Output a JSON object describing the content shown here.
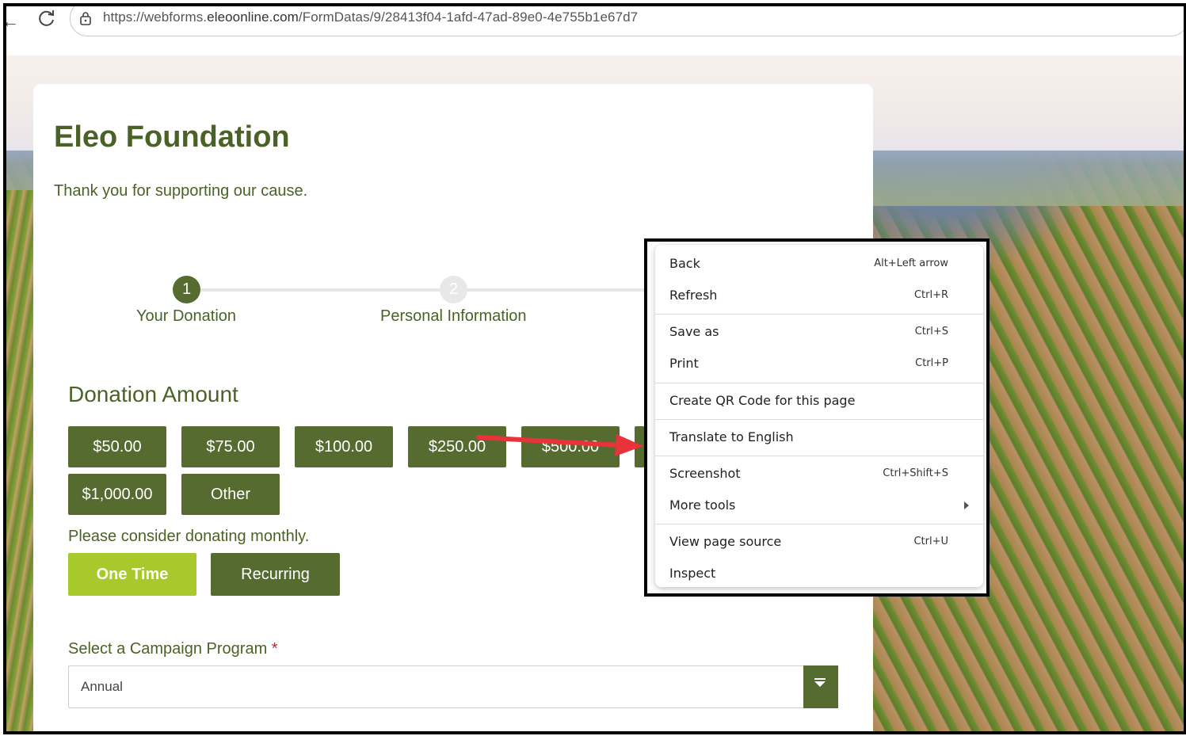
{
  "browser": {
    "url_prefix": "https://webforms.",
    "url_host": "eleoonline.com",
    "url_path": "/FormDatas/9/28413f04-1afd-47ad-89e0-4e755b1e67d7"
  },
  "form": {
    "title": "Eleo Foundation",
    "subtitle": "Thank you for supporting our cause.",
    "steps": [
      {
        "number": "1",
        "label": "Your Donation"
      },
      {
        "number": "2",
        "label": "Personal Information"
      }
    ],
    "donation_heading": "Donation Amount",
    "amounts": [
      "$50.00",
      "$75.00",
      "$100.00",
      "$250.00",
      "$500.00",
      "$1,000.00",
      "Other"
    ],
    "monthly_prompt": "Please consider donating monthly.",
    "frequency": {
      "one_time": "One Time",
      "recurring": "Recurring"
    },
    "campaign_label": "Select a Campaign Program",
    "required_mark": "*",
    "campaign_value": "Annual"
  },
  "context_menu": {
    "items": [
      {
        "label": "Back",
        "shortcut": "Alt+Left arrow"
      },
      {
        "label": "Refresh",
        "shortcut": "Ctrl+R"
      },
      {
        "label": "Save as",
        "shortcut": "Ctrl+S"
      },
      {
        "label": "Print",
        "shortcut": "Ctrl+P"
      },
      {
        "label": "Create QR Code for this page",
        "shortcut": ""
      },
      {
        "label": "Translate to English",
        "shortcut": ""
      },
      {
        "label": "Screenshot",
        "shortcut": "Ctrl+Shift+S"
      },
      {
        "label": "More tools",
        "shortcut": ""
      },
      {
        "label": "View page source",
        "shortcut": "Ctrl+U"
      },
      {
        "label": "Inspect",
        "shortcut": ""
      }
    ]
  },
  "colors": {
    "brand_green": "#556b2f",
    "accent_lime": "#a8c92c",
    "text_green": "#4b6227",
    "annotation_red": "#e8333a"
  }
}
